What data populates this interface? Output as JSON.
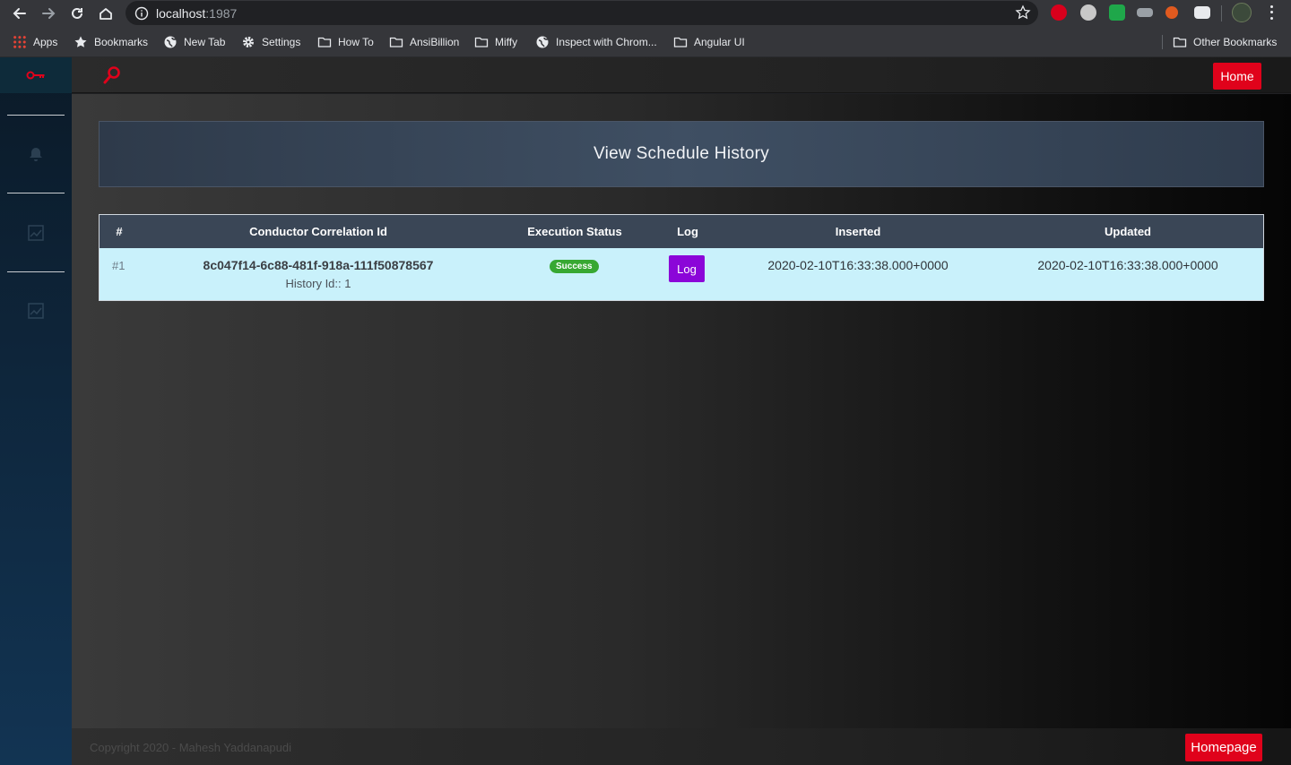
{
  "browser": {
    "url_host": "localhost",
    "url_port": ":1987",
    "bookmarks": [
      {
        "label": "Apps",
        "icon": "apps-grid-icon"
      },
      {
        "label": "Bookmarks",
        "icon": "star-icon"
      },
      {
        "label": "New Tab",
        "icon": "globe-icon"
      },
      {
        "label": "Settings",
        "icon": "gear-icon"
      },
      {
        "label": "How To",
        "icon": "folder-icon"
      },
      {
        "label": "AnsiBillion",
        "icon": "folder-icon"
      },
      {
        "label": "Miffy",
        "icon": "folder-icon"
      },
      {
        "label": "Inspect with Chrom...",
        "icon": "globe-icon"
      },
      {
        "label": "Angular UI",
        "icon": "folder-icon"
      }
    ],
    "other_bookmarks": "Other Bookmarks"
  },
  "topbar": {
    "home_label": "Home"
  },
  "page": {
    "title": "View Schedule History"
  },
  "table": {
    "columns": [
      "#",
      "Conductor Correlation Id",
      "Execution Status",
      "Log",
      "Inserted",
      "Updated"
    ],
    "rows": [
      {
        "index": "#1",
        "correlation_id": "8c047f14-6c88-481f-918a-111f50878567",
        "history_id": "History Id:: 1",
        "status": "Success",
        "log_label": "Log",
        "inserted": "2020-02-10T16:33:38.000+0000",
        "updated": "2020-02-10T16:33:38.000+0000"
      }
    ]
  },
  "footer": {
    "copyright": "Copyright 2020 - Mahesh Yaddanapudi",
    "homepage_label": "Homepage"
  },
  "colors": {
    "accent_red": "#e0021b",
    "log_purple": "#8b06d8",
    "success_green": "#37a832",
    "row_bg": "#c9f1fb",
    "table_header": "#3a4656"
  }
}
